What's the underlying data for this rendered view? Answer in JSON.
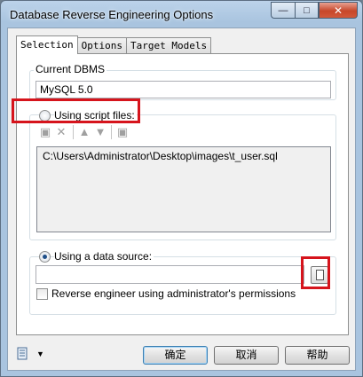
{
  "window": {
    "title": "Database Reverse Engineering Options",
    "minimize_glyph": "—",
    "maximize_glyph": "□",
    "close_glyph": "✕"
  },
  "tabs": [
    {
      "label": "Selection",
      "active": true
    },
    {
      "label": "Options",
      "active": false
    },
    {
      "label": "Target Models",
      "active": false
    }
  ],
  "current_dbms": {
    "label": "Current DBMS",
    "value": "MySQL 5.0"
  },
  "script_files": {
    "label": "Using script files:",
    "selected": false,
    "toolbar_icons": [
      "add-file-icon",
      "delete-icon",
      "move-up-icon",
      "move-down-icon",
      "save-icon"
    ],
    "files": [
      "C:\\Users\\Administrator\\Desktop\\images\\t_user.sql"
    ]
  },
  "data_source": {
    "label": "Using a data source:",
    "selected": true,
    "value": "",
    "browse_icon": "browse-datasource-icon",
    "admin_permissions_label": "Reverse engineer using administrator's permissions",
    "admin_permissions_checked": false
  },
  "footer": {
    "menu_icon": "list-menu-icon",
    "ok_label": "确定",
    "cancel_label": "取消",
    "help_label": "帮助"
  },
  "colors": {
    "highlight": "#d6141c",
    "title_bar": "#a9c4df"
  }
}
